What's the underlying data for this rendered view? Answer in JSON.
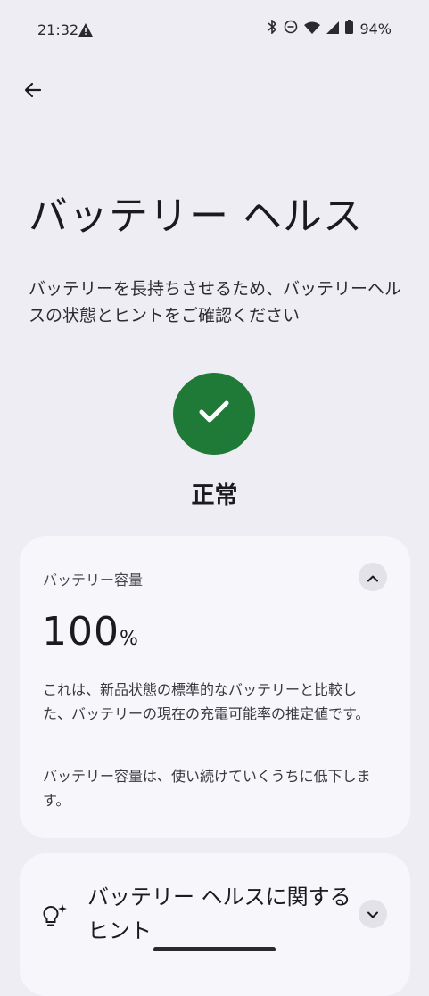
{
  "status_bar": {
    "time": "21:32",
    "battery_percent": "94%",
    "icons": [
      "warning-icon",
      "bluetooth-icon",
      "do-not-disturb-icon",
      "wifi-icon",
      "cell-signal-icon",
      "battery-icon"
    ]
  },
  "header": {
    "back_icon": "arrow-back-icon",
    "title": "バッテリー ヘルス",
    "description": "バッテリーを長持ちさせるため、バッテリーヘルスの状態とヒントをご確認ください"
  },
  "health_status": {
    "icon": "check-icon",
    "color": "#1f7a38",
    "label": "正常"
  },
  "capacity_card": {
    "heading": "バッテリー容量",
    "value": "100",
    "unit": "%",
    "explanation": "これは、新品状態の標準的なバッテリーと比較した、バッテリーの現在の充電可能率の推定値です。",
    "note": "バッテリー容量は、使い続けていくうちに低下します。",
    "toggle_icon": "chevron-up-icon"
  },
  "tips_card": {
    "icon": "lightbulb-sparkle-icon",
    "title": "バッテリー ヘルスに関するヒント",
    "toggle_icon": "chevron-down-icon"
  }
}
